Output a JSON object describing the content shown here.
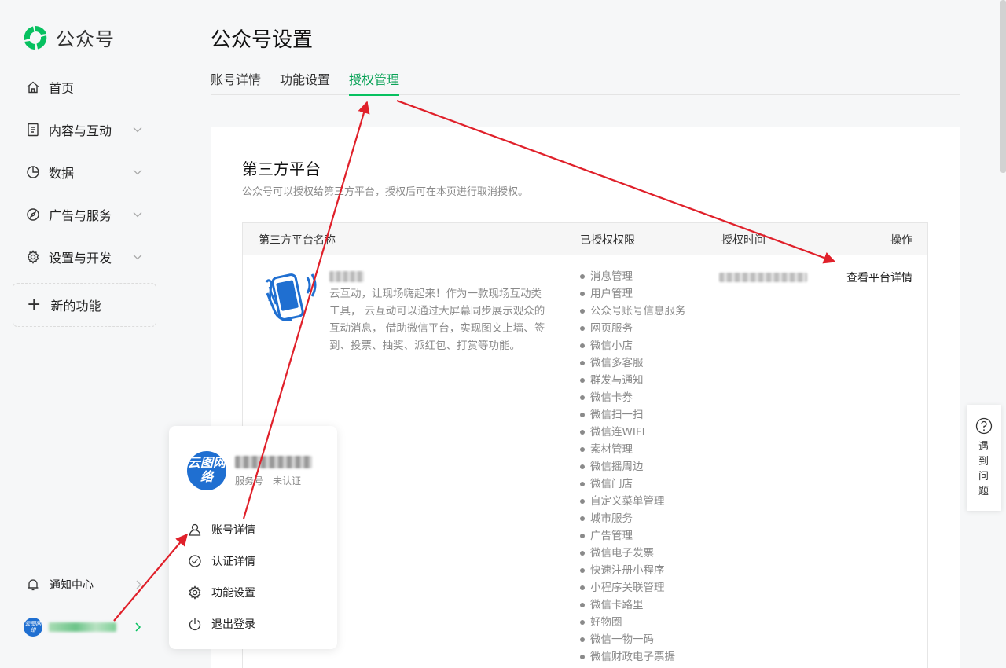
{
  "brand": {
    "name": "公众号",
    "accent_color": "#07c160"
  },
  "sidebar": {
    "items": [
      {
        "label": "首页",
        "icon": "home-icon",
        "has_chevron": false
      },
      {
        "label": "内容与互动",
        "icon": "document-icon",
        "has_chevron": true
      },
      {
        "label": "数据",
        "icon": "pie-chart-icon",
        "has_chevron": true
      },
      {
        "label": "广告与服务",
        "icon": "compass-icon",
        "has_chevron": true
      },
      {
        "label": "设置与开发",
        "icon": "gear-icon",
        "has_chevron": true
      }
    ],
    "new_feature_label": "新的功能",
    "notify_label": "通知中心",
    "account_avatar_text": "云图网络"
  },
  "main": {
    "title": "公众号设置",
    "tabs": [
      {
        "label": "账号详情",
        "active": false
      },
      {
        "label": "功能设置",
        "active": false
      },
      {
        "label": "授权管理",
        "active": true
      }
    ]
  },
  "third_party": {
    "title": "第三方平台",
    "description": "公众号可以授权给第三方平台，授权后可在本页进行取消授权。",
    "columns": [
      "第三方平台名称",
      "已授权权限",
      "授权时间",
      "操作"
    ],
    "rows": [
      {
        "description": "云互动，让现场嗨起来！作为一款现场互动类工具， 云互动可以通过大屏幕同步展示观众的互动消息， 借助微信平台，实现图文上墙、签到、投票、抽奖、派红包、打赏等功能。",
        "permissions": [
          "消息管理",
          "用户管理",
          "公众号账号信息服务",
          "网页服务",
          "微信小店",
          "微信多客服",
          "群发与通知",
          "微信卡券",
          "微信扫一扫",
          "微信连WIFI",
          "素材管理",
          "微信摇周边",
          "微信门店",
          "自定义菜单管理",
          "城市服务",
          "广告管理",
          "微信电子发票",
          "快速注册小程序",
          "小程序关联管理",
          "微信卡路里",
          "好物圈",
          "微信一物一码",
          "微信财政电子票据"
        ],
        "action": "查看平台详情"
      }
    ]
  },
  "account_popup": {
    "avatar_text": "云图网络",
    "type": "服务号",
    "verification": "未认证",
    "menu": [
      {
        "label": "账号详情",
        "icon": "user-icon"
      },
      {
        "label": "认证详情",
        "icon": "check-circle-icon"
      },
      {
        "label": "功能设置",
        "icon": "gear-icon"
      },
      {
        "label": "退出登录",
        "icon": "power-icon"
      }
    ]
  },
  "help": {
    "label": "遇到问题"
  },
  "annotation_color": "#e0202a"
}
